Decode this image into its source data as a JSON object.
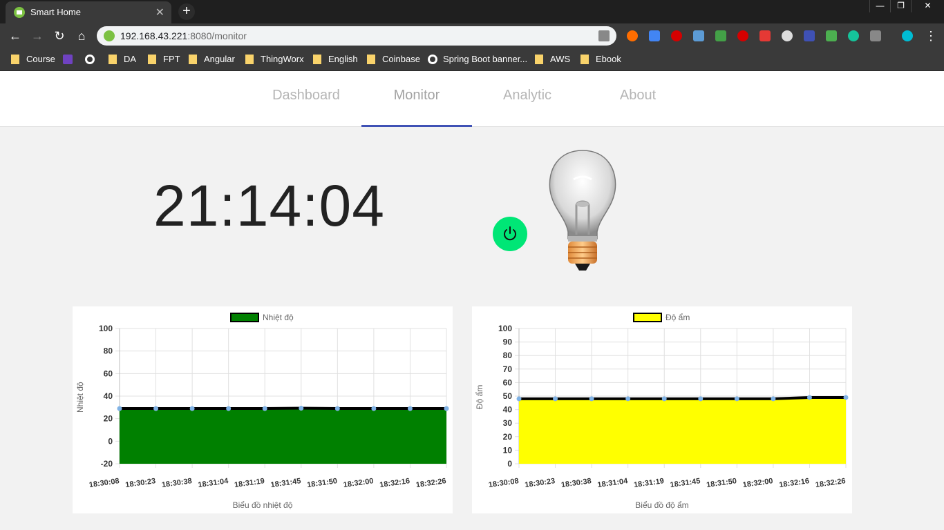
{
  "browser": {
    "tab_title": "Smart Home",
    "url_host": "192.168.43.221",
    "url_path": ":8080/monitor",
    "bookmarks": [
      "Course",
      "DA",
      "FPT",
      "Angular",
      "ThingWorx",
      "English",
      "Coinbase",
      "Spring Boot banner...",
      "AWS",
      "Ebook"
    ]
  },
  "nav": {
    "items": [
      {
        "label": "Dashboard"
      },
      {
        "label": "Monitor"
      },
      {
        "label": "Analytic"
      },
      {
        "label": "About"
      }
    ],
    "active": "Monitor"
  },
  "clock": "21:14:04",
  "colors": {
    "accent": "#3f51b5",
    "power_button": "#00e676",
    "temperature_fill": "#008000",
    "humidity_fill": "#ffff00"
  },
  "chart_data": [
    {
      "type": "area",
      "legend": "Nhiệt độ",
      "xlabel": "Biểu đồ nhiệt độ",
      "ylabel": "Nhiệt độ",
      "ylim": [
        -20,
        100
      ],
      "yticks": [
        100,
        80,
        60,
        40,
        20,
        0,
        -20
      ],
      "categories": [
        "18:30:08",
        "18:30:23",
        "18:30:38",
        "18:31:04",
        "18:31:19",
        "18:31:45",
        "18:31:50",
        "18:32:00",
        "18:32:16",
        "18:32:26"
      ],
      "values": [
        29,
        29,
        29,
        29,
        29,
        29.3,
        29,
        29,
        29,
        29
      ],
      "fill": "#008000",
      "grid": true,
      "legend_position": "top"
    },
    {
      "type": "area",
      "legend": "Độ ẩm",
      "xlabel": "Biểu đồ độ ẩm",
      "ylabel": "Độ ẩm",
      "ylim": [
        0,
        100
      ],
      "yticks": [
        100,
        90,
        80,
        70,
        60,
        50,
        40,
        30,
        20,
        10,
        0
      ],
      "categories": [
        "18:30:08",
        "18:30:23",
        "18:30:38",
        "18:31:04",
        "18:31:19",
        "18:31:45",
        "18:31:50",
        "18:32:00",
        "18:32:16",
        "18:32:26"
      ],
      "values": [
        48,
        48,
        48,
        48,
        48,
        48,
        48,
        48,
        49,
        49
      ],
      "fill": "#ffff00",
      "grid": true,
      "legend_position": "top"
    }
  ]
}
